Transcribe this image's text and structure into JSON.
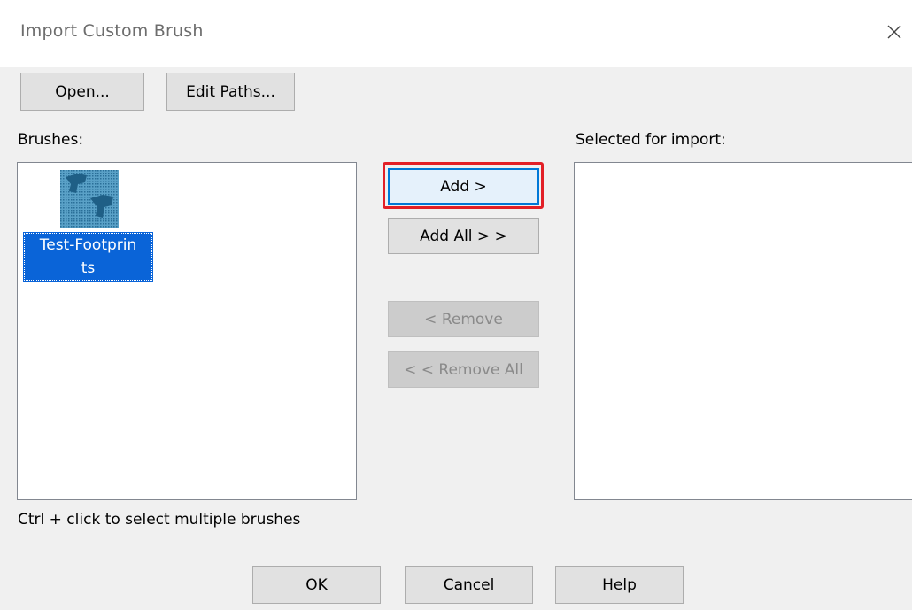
{
  "dialog": {
    "title": "Import Custom Brush",
    "close_icon": "close-icon"
  },
  "toolbar": {
    "open_label": "Open...",
    "edit_paths_label": "Edit Paths..."
  },
  "brushes": {
    "label": "Brushes:",
    "items": [
      {
        "name_line1": "Test-Footprin",
        "name_line2": "ts",
        "icon": "footprints-brush-thumbnail",
        "selected": true
      }
    ],
    "hint": "Ctrl + click to select multiple brushes"
  },
  "middle": {
    "add_label": "Add >",
    "add_all_label": "Add All > >",
    "remove_label": "< Remove",
    "remove_all_label": "< < Remove All"
  },
  "selected": {
    "label": "Selected for import:"
  },
  "footer": {
    "ok_label": "OK",
    "cancel_label": "Cancel",
    "help_label": "Help"
  },
  "colors": {
    "selection": "#0a64d8",
    "focus_border": "#0078d7",
    "annotation": "#e21f26"
  }
}
